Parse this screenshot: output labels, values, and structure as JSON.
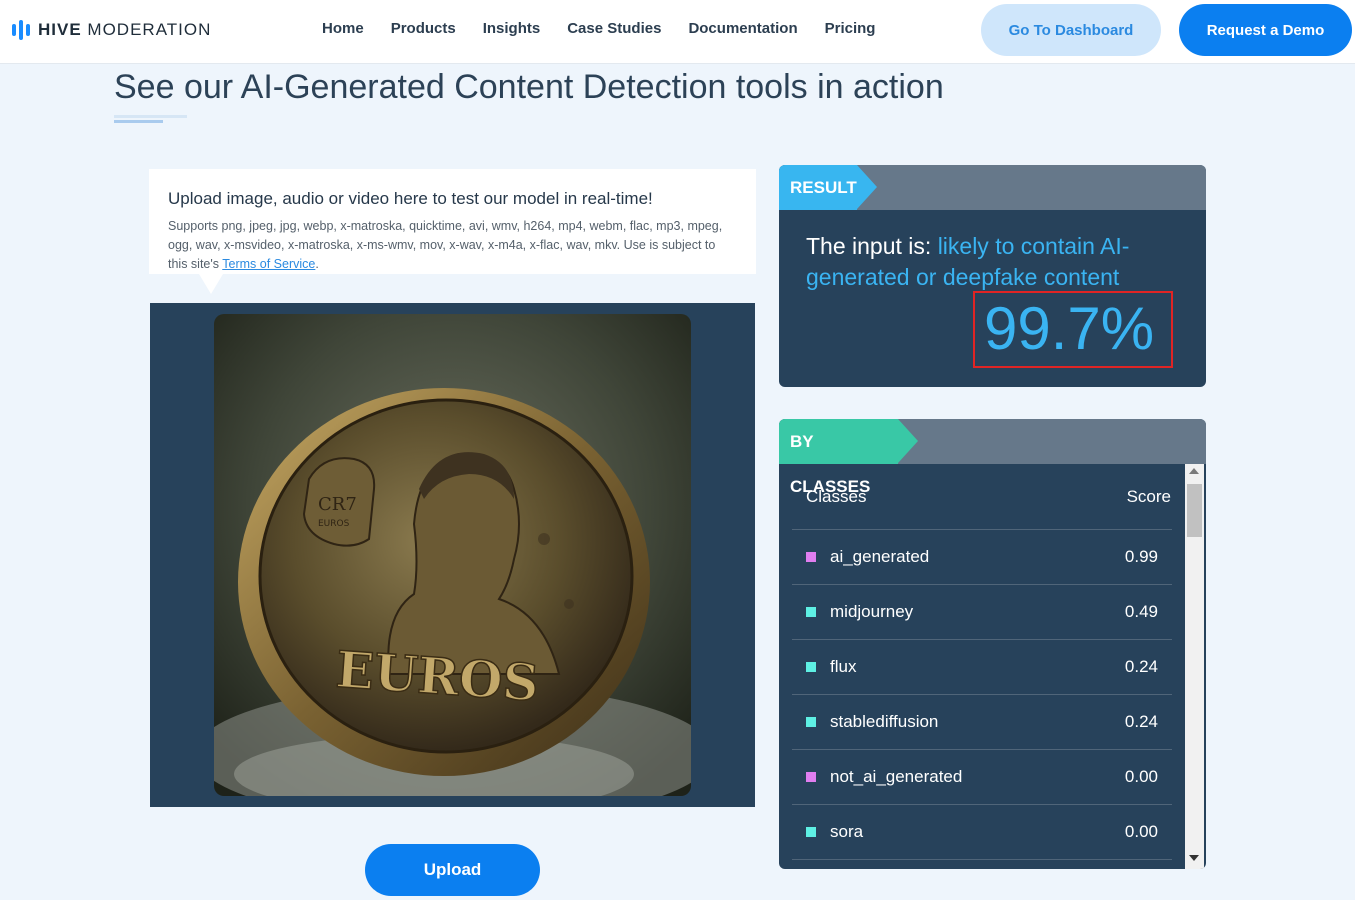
{
  "nav": {
    "brand_bold": "HIVE",
    "brand_light": "MODERATION",
    "links": [
      "Home",
      "Products",
      "Insights",
      "Case Studies",
      "Documentation",
      "Pricing"
    ],
    "dashboard_label": "Go To Dashboard",
    "demo_label": "Request a Demo"
  },
  "page": {
    "heading": "See our AI-Generated Content Detection tools in action"
  },
  "upload": {
    "title": "Upload image, audio or video here to test our model in real-time!",
    "supports": "Supports png, jpeg, jpg, webp, x-matroska, quicktime, avi, wmv, h264, mp4, webm, flac, mp3, mpeg, ogg, wav, x-msvideo, x-matroska, x-ms-wmv, mov, x-wav, x-m4a, x-flac, wav, mkv. Use is subject to this site's",
    "terms_link": "Terms of Service",
    "terms_suffix": ".",
    "button_label": "Upload",
    "coin_text": "EUROS",
    "coin_badge_top": "CR7",
    "coin_badge_bottom": "EUROS"
  },
  "result": {
    "tag": "RESULT",
    "prefix": "The input is: ",
    "verdict": "likely to contain AI-generated or deepfake content",
    "score": "99.7%"
  },
  "classes": {
    "tag": "BY CLASSES",
    "col_class": "Classes",
    "col_score": "Score",
    "rows": [
      {
        "name": "ai_generated",
        "score": "0.99",
        "color": "#e07ef0"
      },
      {
        "name": "midjourney",
        "score": "0.49",
        "color": "#5ef0e4"
      },
      {
        "name": "flux",
        "score": "0.24",
        "color": "#5ef0e4"
      },
      {
        "name": "stablediffusion",
        "score": "0.24",
        "color": "#5ef0e4"
      },
      {
        "name": "not_ai_generated",
        "score": "0.00",
        "color": "#e07ef0"
      },
      {
        "name": "sora",
        "score": "0.00",
        "color": "#5ef0e4"
      }
    ]
  }
}
